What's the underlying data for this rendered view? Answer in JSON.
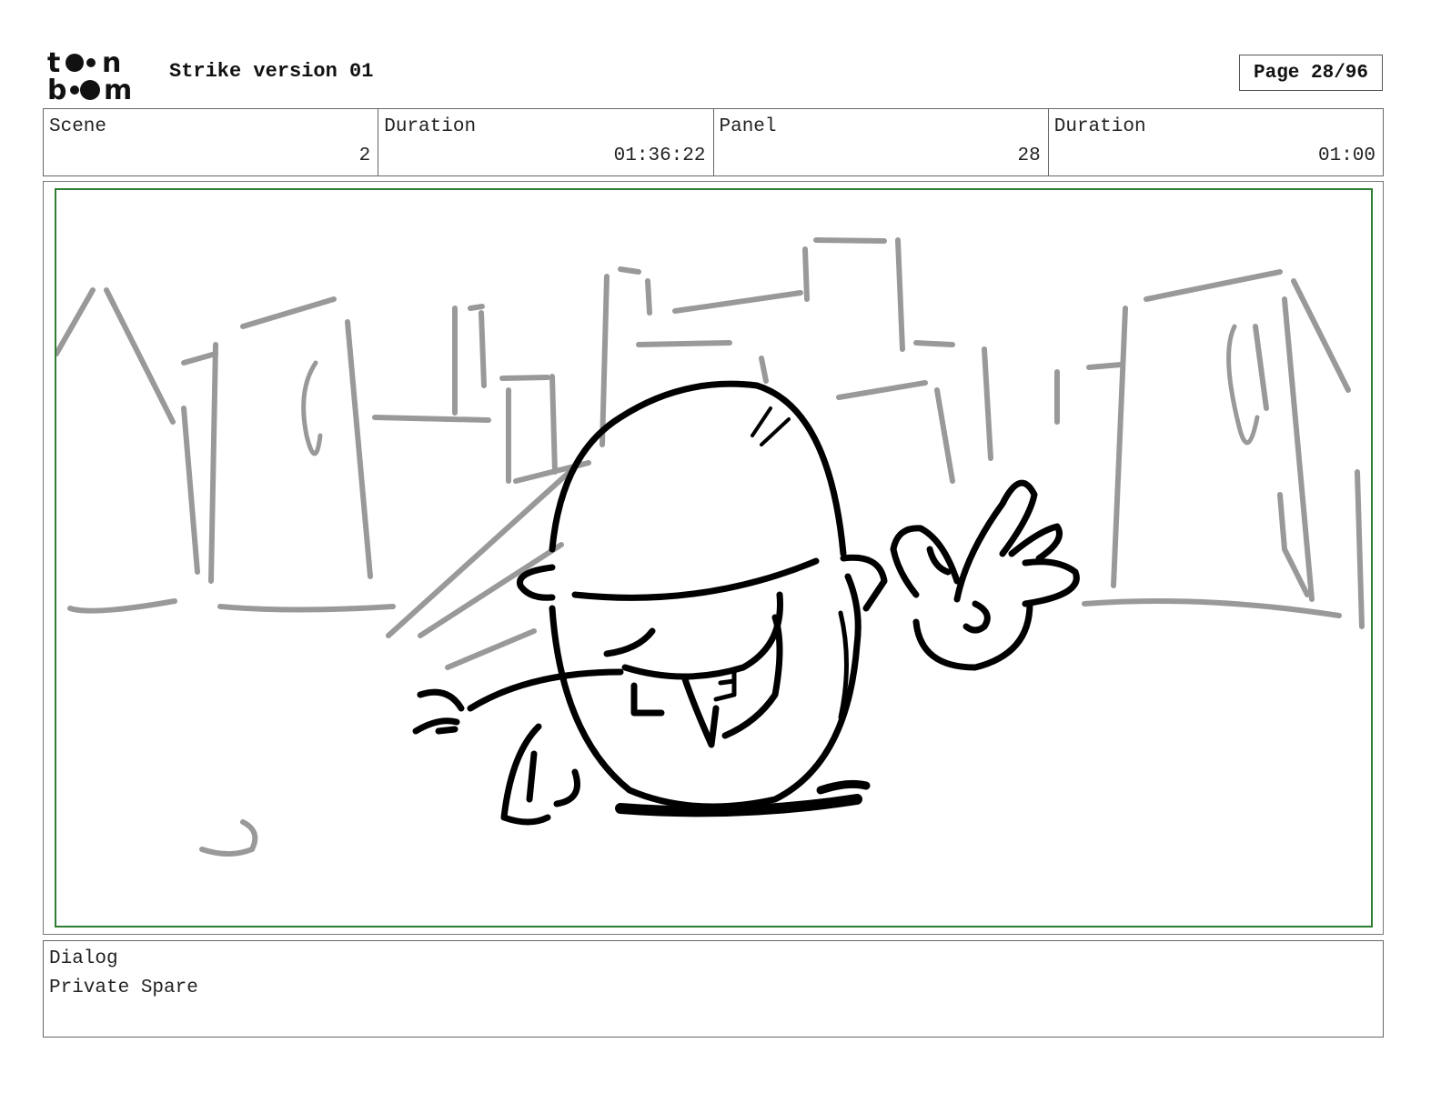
{
  "header": {
    "logo_text": "toon boom",
    "title": "Strike version 01",
    "page": "Page 28/96"
  },
  "info": {
    "scene_label": "Scene",
    "scene_value": "2",
    "scene_duration_label": "Duration",
    "scene_duration_value": "01:36:22",
    "panel_label": "Panel",
    "panel_value": "28",
    "panel_duration_label": "Duration",
    "panel_duration_value": "01:00"
  },
  "dialog": {
    "label": "Dialog",
    "text": "Private Spare"
  },
  "colors": {
    "frame_border": "#2e7d32",
    "sketch_background": "#999999",
    "sketch_character": "#000000"
  }
}
